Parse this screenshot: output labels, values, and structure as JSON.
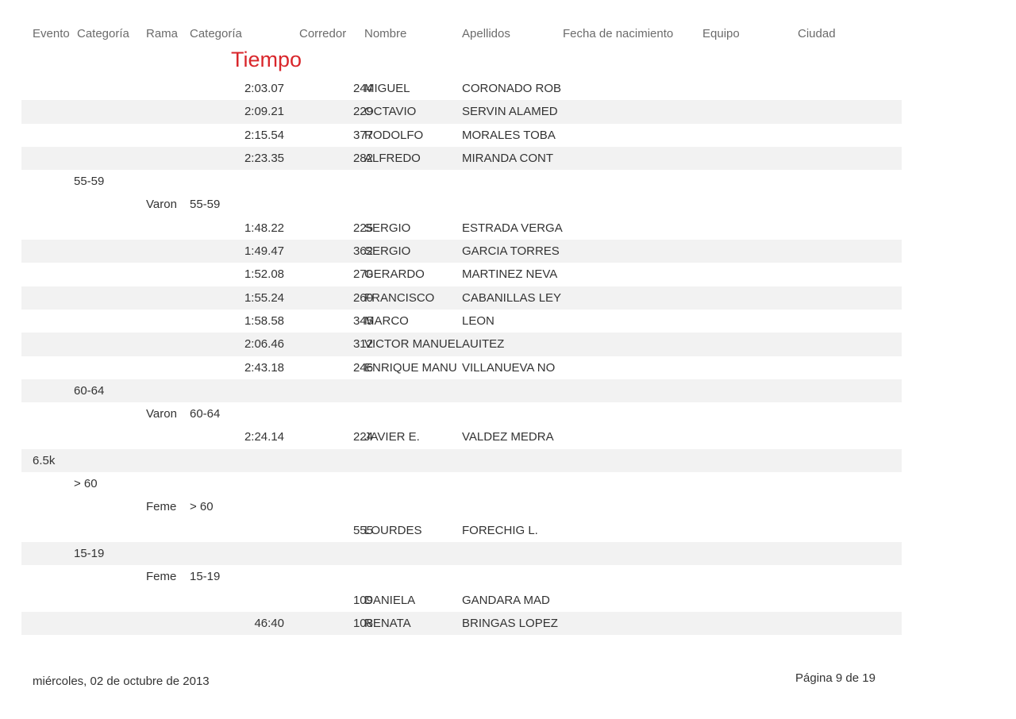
{
  "headers": {
    "evento": "Evento",
    "categoria": "Categoría",
    "rama": "Rama",
    "categoria2": "Categoría",
    "corredor": "Corredor",
    "nombre": "Nombre",
    "apellidos": "Apellidos",
    "fecha": "Fecha de nacimiento",
    "equipo": "Equipo",
    "ciudad": "Ciudad"
  },
  "tiempo_label": "Tiempo",
  "rows": [
    {
      "evento": "",
      "categoria": "",
      "rama": "",
      "categoria2": "",
      "tiempo": "2:03.07",
      "corredor": "244",
      "nombre": "MIGUEL",
      "apellidos": "CORONADO ROB",
      "shade": false
    },
    {
      "evento": "",
      "categoria": "",
      "rama": "",
      "categoria2": "",
      "tiempo": "2:09.21",
      "corredor": "229",
      "nombre": "OCTAVIO",
      "apellidos": "SERVIN ALAMED",
      "shade": true
    },
    {
      "evento": "",
      "categoria": "",
      "rama": "",
      "categoria2": "",
      "tiempo": "2:15.54",
      "corredor": "377",
      "nombre": "RODOLFO",
      "apellidos": "MORALES TOBA",
      "shade": false
    },
    {
      "evento": "",
      "categoria": "",
      "rama": "",
      "categoria2": "",
      "tiempo": "2:23.35",
      "corredor": "282",
      "nombre": "ALFREDO",
      "apellidos": "MIRANDA CONT",
      "shade": true
    },
    {
      "evento": "",
      "categoria": "55-59",
      "rama": "",
      "categoria2": "",
      "tiempo": "",
      "corredor": "",
      "nombre": "",
      "apellidos": "",
      "shade": false
    },
    {
      "evento": "",
      "categoria": "",
      "rama": "Varon",
      "categoria2": "55-59",
      "tiempo": "",
      "corredor": "",
      "nombre": "",
      "apellidos": "",
      "shade": false
    },
    {
      "evento": "",
      "categoria": "",
      "rama": "",
      "categoria2": "",
      "tiempo": "1:48.22",
      "corredor": "225",
      "nombre": "SERGIO",
      "apellidos": "ESTRADA VERGA",
      "shade": false
    },
    {
      "evento": "",
      "categoria": "",
      "rama": "",
      "categoria2": "",
      "tiempo": "1:49.47",
      "corredor": "362",
      "nombre": "SERGIO",
      "apellidos": "GARCIA TORRES",
      "shade": true
    },
    {
      "evento": "",
      "categoria": "",
      "rama": "",
      "categoria2": "",
      "tiempo": "1:52.08",
      "corredor": "270",
      "nombre": "GERARDO",
      "apellidos": "MARTINEZ NEVA",
      "shade": false
    },
    {
      "evento": "",
      "categoria": "",
      "rama": "",
      "categoria2": "",
      "tiempo": "1:55.24",
      "corredor": "260",
      "nombre": "FRANCISCO",
      "apellidos": "CABANILLAS LEY",
      "shade": true
    },
    {
      "evento": "",
      "categoria": "",
      "rama": "",
      "categoria2": "",
      "tiempo": "1:58.58",
      "corredor": "345",
      "nombre": "MARCO",
      "apellidos": "LEON",
      "shade": false
    },
    {
      "evento": "",
      "categoria": "",
      "rama": "",
      "categoria2": "",
      "tiempo": "2:06.46",
      "corredor": "312",
      "nombre": "VICTOR MANUEL",
      "apellidos": "AUITEZ",
      "shade": true
    },
    {
      "evento": "",
      "categoria": "",
      "rama": "",
      "categoria2": "",
      "tiempo": "2:43.18",
      "corredor": "246",
      "nombre": "ENRIQUE MANU",
      "apellidos": "VILLANUEVA NO",
      "shade": false
    },
    {
      "evento": "",
      "categoria": "60-64",
      "rama": "",
      "categoria2": "",
      "tiempo": "",
      "corredor": "",
      "nombre": "",
      "apellidos": "",
      "shade": true
    },
    {
      "evento": "",
      "categoria": "",
      "rama": "Varon",
      "categoria2": "60-64",
      "tiempo": "",
      "corredor": "",
      "nombre": "",
      "apellidos": "",
      "shade": false
    },
    {
      "evento": "",
      "categoria": "",
      "rama": "",
      "categoria2": "",
      "tiempo": "2:24.14",
      "corredor": "224",
      "nombre": "JAVIER E.",
      "apellidos": "VALDEZ MEDRA",
      "shade": false
    },
    {
      "evento": "6.5k",
      "categoria": "",
      "rama": "",
      "categoria2": "",
      "tiempo": "",
      "corredor": "",
      "nombre": "",
      "apellidos": "",
      "shade": true
    },
    {
      "evento": "",
      "categoria": "> 60",
      "rama": "",
      "categoria2": "",
      "tiempo": "",
      "corredor": "",
      "nombre": "",
      "apellidos": "",
      "shade": false
    },
    {
      "evento": "",
      "categoria": "",
      "rama": "Feme",
      "categoria2": "> 60",
      "tiempo": "",
      "corredor": "",
      "nombre": "",
      "apellidos": "",
      "shade": false
    },
    {
      "evento": "",
      "categoria": "",
      "rama": "",
      "categoria2": "",
      "tiempo": "",
      "corredor": "555",
      "nombre": "LOURDES",
      "apellidos": "FORECHIG L.",
      "shade": false
    },
    {
      "evento": "",
      "categoria": "15-19",
      "rama": "",
      "categoria2": "",
      "tiempo": "",
      "corredor": "",
      "nombre": "",
      "apellidos": "",
      "shade": true
    },
    {
      "evento": "",
      "categoria": "",
      "rama": "Feme",
      "categoria2": "15-19",
      "tiempo": "",
      "corredor": "",
      "nombre": "",
      "apellidos": "",
      "shade": false
    },
    {
      "evento": "",
      "categoria": "",
      "rama": "",
      "categoria2": "",
      "tiempo": "",
      "corredor": "109",
      "nombre": "DANIELA",
      "apellidos": "GANDARA MAD",
      "shade": false
    },
    {
      "evento": "",
      "categoria": "",
      "rama": "",
      "categoria2": "",
      "tiempo": "46:40",
      "corredor": "108",
      "nombre": "RENATA",
      "apellidos": "BRINGAS LOPEZ",
      "shade": true
    }
  ],
  "footer": {
    "date": "miércoles, 02 de octubre de 2013",
    "page": "Página 9 de 19"
  }
}
